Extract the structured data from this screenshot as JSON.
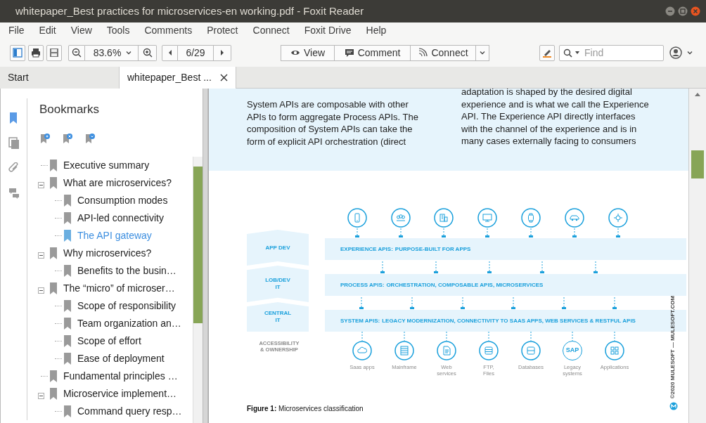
{
  "window": {
    "title": "whitepaper_Best practices for microservices-en working.pdf - Foxit Reader"
  },
  "menu": [
    "File",
    "Edit",
    "View",
    "Tools",
    "Comments",
    "Protect",
    "Connect",
    "Foxit Drive",
    "Help"
  ],
  "toolbar": {
    "zoom": "83.6%",
    "page": "6/29",
    "modes": [
      "View",
      "Comment",
      "Connect"
    ],
    "find_placeholder": "Find"
  },
  "tabs": [
    {
      "label": "Start",
      "selected": false
    },
    {
      "label": "whitepaper_Best ...",
      "selected": true
    }
  ],
  "side_panels": [
    {
      "kind": "bookmarks",
      "selected": true
    },
    {
      "kind": "pages",
      "selected": false
    },
    {
      "kind": "attachments",
      "selected": false
    },
    {
      "kind": "comments",
      "selected": false
    }
  ],
  "bookmarks": {
    "title": "Bookmarks",
    "items": [
      {
        "label": "Executive summary",
        "selected": false
      },
      {
        "label": "What are microservices?",
        "selected": false,
        "expanded": true,
        "children": [
          {
            "label": "Consumption modes",
            "selected": false
          },
          {
            "label": "API-led connectivity",
            "selected": false
          },
          {
            "label": "The API gateway",
            "selected": true
          }
        ]
      },
      {
        "label": "Why microservices?",
        "selected": false,
        "expanded": true,
        "children": [
          {
            "label": "Benefits to the busin…",
            "selected": false
          }
        ]
      },
      {
        "label": "The “micro” of microser…",
        "selected": false,
        "expanded": true,
        "children": [
          {
            "label": "Scope of responsibility",
            "selected": false
          },
          {
            "label": "Team organization an…",
            "selected": false
          },
          {
            "label": "Scope of effort",
            "selected": false
          },
          {
            "label": "Ease of deployment",
            "selected": false
          }
        ]
      },
      {
        "label": "Fundamental principles …",
        "selected": false
      },
      {
        "label": "Microservice implement…",
        "selected": false,
        "expanded": true,
        "children": [
          {
            "label": "Command query resp…",
            "selected": false
          }
        ]
      }
    ]
  },
  "document": {
    "columns": [
      [
        "System APIs are composable with other",
        "APIs to form aggregate Process APIs. The",
        "composition of System APIs can take the",
        "form of explicit API orchestration (direct"
      ],
      [
        "adaptation is shaped by the desired digital",
        "experience and is what we call the Experience",
        "API. The Experience API directly interfaces",
        "with the channel of the experience and is in",
        "many cases externally facing to consumers"
      ]
    ],
    "diagram": {
      "layers": [
        [
          "APP DEV"
        ],
        [
          "LOB/DEV",
          "IT"
        ],
        [
          "CENTRAL",
          "IT"
        ]
      ],
      "layers_caption": [
        "ACCESSIBILITY",
        "& OWNERSHIP"
      ],
      "bands": [
        {
          "title": "EXPERIENCE APIS:",
          "text": "PURPOSE-BUILT FOR APPS"
        },
        {
          "title": "PROCESS APIS:",
          "text": "ORCHESTRATION, COMPOSABLE APIS, MICROSERVICES"
        },
        {
          "title": "SYSTEM APIS:",
          "text": "LEGACY MODERNIZATION, CONNECTIVITY TO SAAS APPS, WEB SERVICES & RESTFUL APIS"
        }
      ],
      "systems": [
        {
          "label": [
            "Saas apps"
          ]
        },
        {
          "label": [
            "Mainframe"
          ]
        },
        {
          "label": [
            "Web",
            "services"
          ]
        },
        {
          "label": [
            "FTP,",
            "Files"
          ]
        },
        {
          "label": [
            "Databases"
          ]
        },
        {
          "label": [
            "Legacy",
            "systems"
          ],
          "badge": "SAP"
        },
        {
          "label": [
            "Applications"
          ]
        }
      ],
      "copyright": "©2020 MULESOFT — MULESOFT.COM"
    },
    "caption": "**Figure 1:** Microservices classification"
  }
}
